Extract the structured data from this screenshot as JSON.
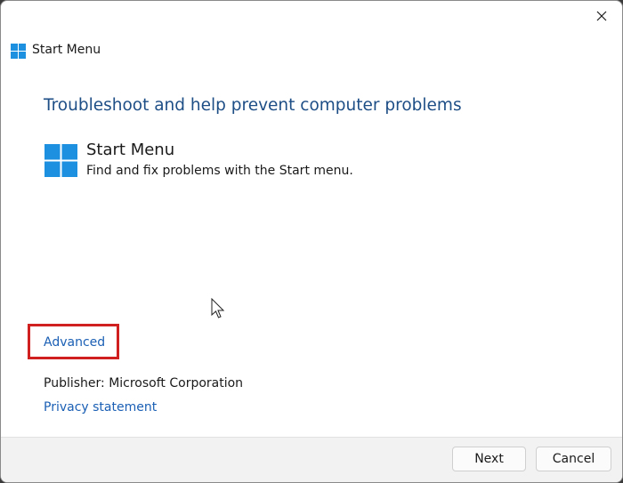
{
  "window": {
    "title": "Start Menu",
    "close_icon": "close-icon",
    "app_icon": "windows-logo-icon"
  },
  "main": {
    "heading": "Troubleshoot and help prevent computer problems",
    "tool": {
      "icon": "windows-logo-icon",
      "name": "Start Menu",
      "description": "Find and fix problems with the Start menu."
    },
    "advanced_link": "Advanced",
    "publisher": "Publisher:  Microsoft Corporation",
    "privacy_link": "Privacy statement",
    "highlight_color": "#d02020",
    "link_color": "#1a5fb4",
    "heading_color": "#1e4e86"
  },
  "footer": {
    "next_label": "Next",
    "cancel_label": "Cancel"
  }
}
